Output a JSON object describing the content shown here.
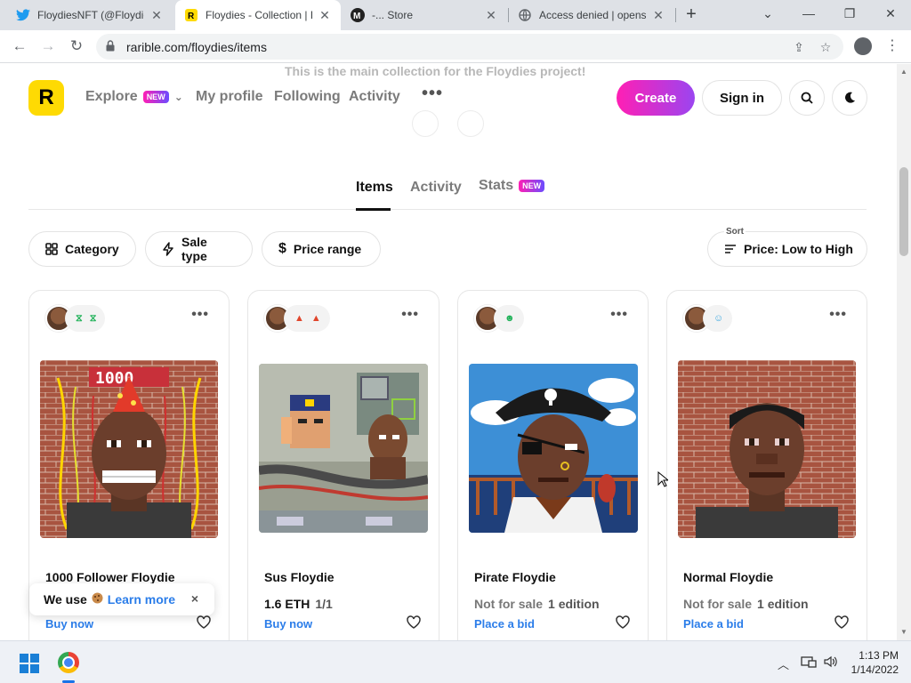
{
  "browser": {
    "tabs": [
      {
        "title": "FloydiesNFT (@Floydie"
      },
      {
        "title": "Floydies - Collection | R"
      },
      {
        "title": "-... Store"
      },
      {
        "title": "Access denied | opense"
      }
    ],
    "url": "rarible.com/floydies/items"
  },
  "page": {
    "ghost_text": "This is the main collection for the Floydies project!"
  },
  "header": {
    "logo": "R",
    "nav": {
      "explore": "Explore",
      "new_badge": "NEW",
      "my_profile": "My profile",
      "following": "Following",
      "activity": "Activity"
    },
    "create": "Create",
    "sign_in": "Sign in"
  },
  "content_tabs": {
    "items": "Items",
    "activity": "Activity",
    "stats": "Stats",
    "stats_badge": "NEW"
  },
  "filters": {
    "category": "Category",
    "sale_type": "Sale type",
    "price_range": "Price range",
    "sort_label": "Sort",
    "sort_value": "Price: Low to High"
  },
  "cards": [
    {
      "name": "1000 Follower Floydie",
      "price": "",
      "edition": "",
      "action": "Buy now",
      "badge_color": "#22b25a",
      "badge_icon": "x"
    },
    {
      "name": "Sus Floydie",
      "price": "1.6 ETH",
      "edition": "1/1",
      "action": "Buy now",
      "badge_color": "#e0452b",
      "badge_icon": "fire"
    },
    {
      "name": "Pirate Floydie",
      "price": "Not for sale",
      "edition": "1 edition",
      "action": "Place a bid",
      "badge_color": "#22b25a",
      "badge_icon": "face"
    },
    {
      "name": "Normal Floydie",
      "price": "Not for sale",
      "edition": "1 edition",
      "action": "Place a bid",
      "badge_color": "#3aa7e0",
      "badge_icon": "smile"
    }
  ],
  "cookie": {
    "text": "We use",
    "learn_more": "Learn more",
    "close": "×"
  },
  "taskbar": {
    "time": "1:13 PM",
    "date": "1/14/2022"
  }
}
